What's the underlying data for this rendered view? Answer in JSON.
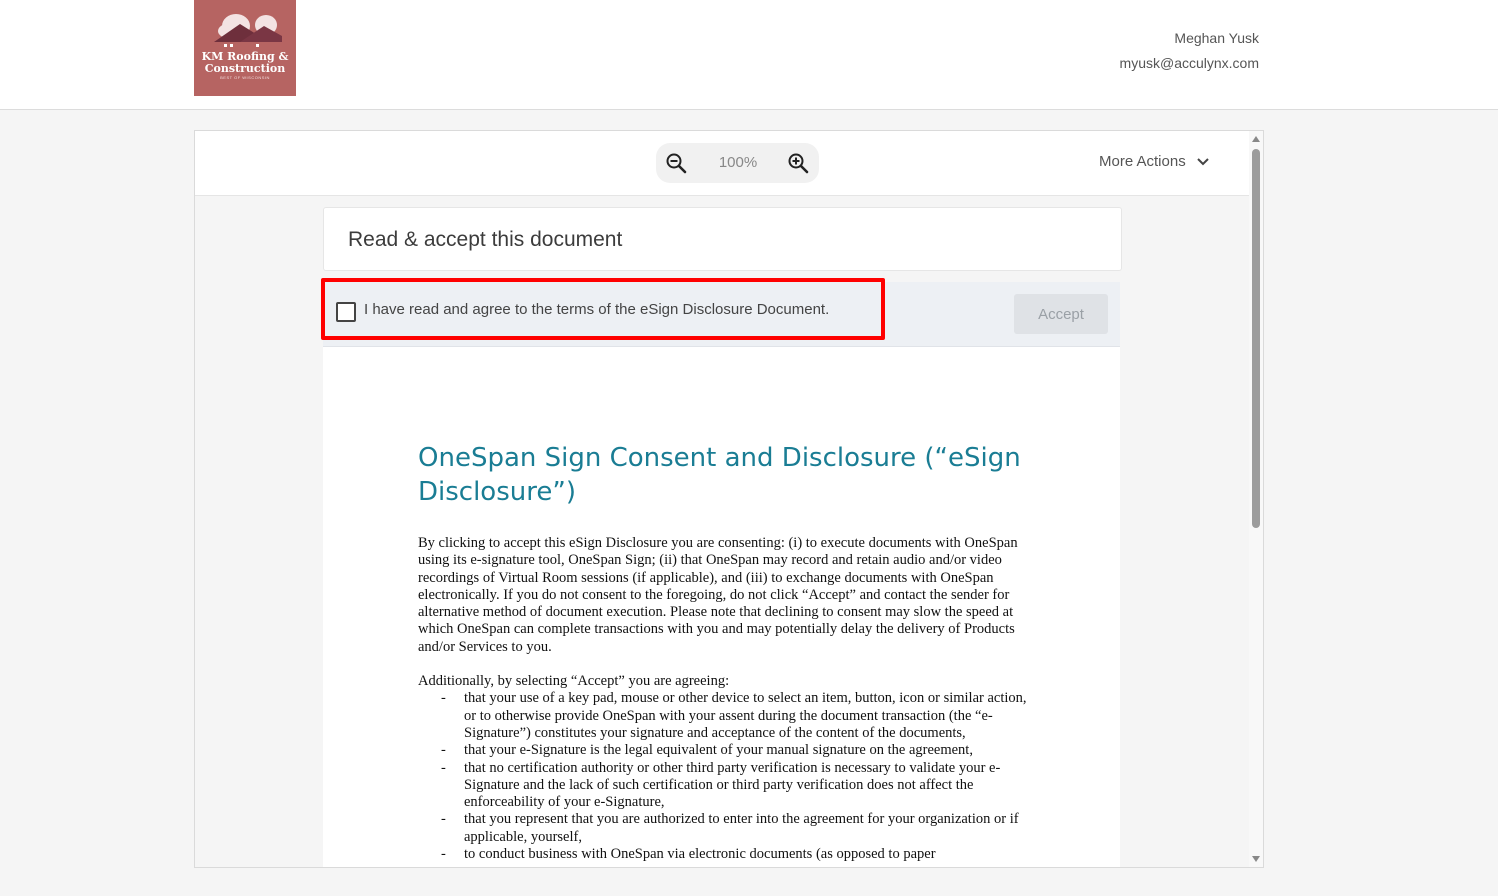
{
  "header": {
    "logo": {
      "line1": "KM Roofing &",
      "line2": "Construction",
      "tagline": "BEST OF WISCONSIN"
    },
    "user": {
      "name": "Meghan Yusk",
      "email": "myusk@acculynx.com"
    }
  },
  "toolbar": {
    "zoom_level": "100%",
    "more_actions_label": "More Actions"
  },
  "card": {
    "title": "Read & accept this document"
  },
  "consent": {
    "checkbox_label": "I have read and agree to the terms of the eSign Disclosure Document.",
    "checked": false,
    "accept_label": "Accept"
  },
  "document": {
    "title": "OneSpan Sign Consent and Disclosure (“eSign Disclosure”)",
    "paragraph1": "By clicking to accept this eSign Disclosure you are consenting: (i) to execute documents with OneSpan using its e-signature tool, OneSpan Sign; (ii) that OneSpan may record and retain audio and/or video recordings of Virtual Room sessions (if applicable), and (iii) to exchange documents with OneSpan electronically. If you do not consent to the foregoing, do not click “Accept” and contact the sender for alternative method of document execution. Please note that declining to consent may slow the speed at which OneSpan can complete transactions with you and may potentially delay the delivery of Products and/or Services to you.",
    "paragraph2": "Additionally, by selecting “Accept” you are agreeing:",
    "bullets": [
      "that your use of a key pad, mouse or other device to select an item, button, icon or similar action, or to otherwise provide OneSpan with your assent during the document transaction (the “e-Signature”) constitutes your signature and acceptance of the content of the documents,",
      "that your e-Signature is the legal equivalent of your manual signature on the agreement,",
      "that no certification authority or other third party verification is necessary to validate your e-Signature and the lack of such certification or third party verification does not affect the enforceability of your e-Signature,",
      "that you represent that you are authorized to enter into the agreement for your organization or if applicable, yourself,",
      "to conduct business with OneSpan via electronic documents (as opposed to paper"
    ]
  },
  "colors": {
    "brand_logo": "#b66462",
    "doc_title": "#1a7d94",
    "highlight": "#ff0000",
    "consent_bg": "#edf0f4"
  }
}
